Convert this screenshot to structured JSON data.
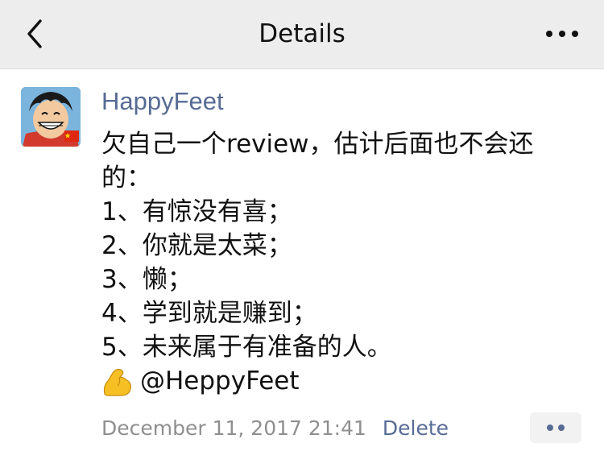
{
  "nav": {
    "title": "Details",
    "back_icon": "chevron-left-icon",
    "more_icon": "ellipsis-icon"
  },
  "post": {
    "author": "HappyFeet",
    "avatar_icon": "avatar-cartoon",
    "text": "欠自己一个review，估计后面也不会还\n的：\n1、有惊没有喜；\n2、你就是太菜；\n3、懒；\n4、学到就是赚到；\n5、未来属于有准备的人。",
    "mention_emoji": "flexed-biceps-emoji",
    "mention": "@HeppyFeet",
    "timestamp": "December 11, 2017 21:41",
    "delete_label": "Delete",
    "action_icon": "two-dots-icon"
  },
  "colors": {
    "nav_bg": "#ededed",
    "link": "#576b95",
    "meta": "#8f8f8f"
  }
}
